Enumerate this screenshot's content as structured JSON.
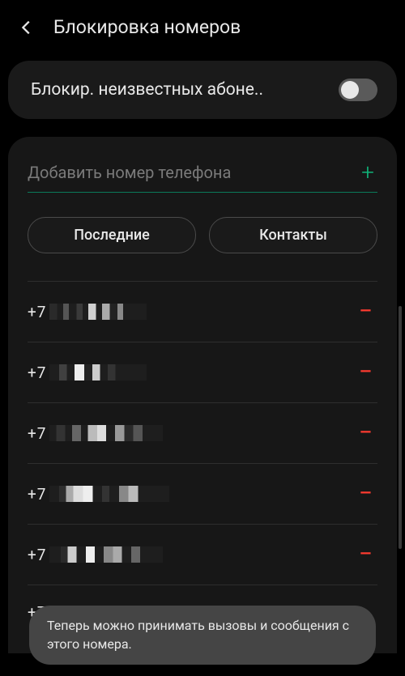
{
  "header": {
    "title": "Блокировка номеров"
  },
  "unknown_toggle": {
    "label": "Блокир. неизвестных абоне..",
    "state": false
  },
  "add_input": {
    "placeholder": "Добавить номер телефона"
  },
  "pills": {
    "recent": "Последние",
    "contacts": "Контакты"
  },
  "blocked_numbers": [
    {
      "prefix": "+7"
    },
    {
      "prefix": "+7"
    },
    {
      "prefix": "+7"
    },
    {
      "prefix": "+7"
    },
    {
      "prefix": "+7"
    },
    {
      "prefix": "+7"
    }
  ],
  "toast": {
    "message": "Теперь можно принимать вызовы и сообщения с этого номера."
  }
}
